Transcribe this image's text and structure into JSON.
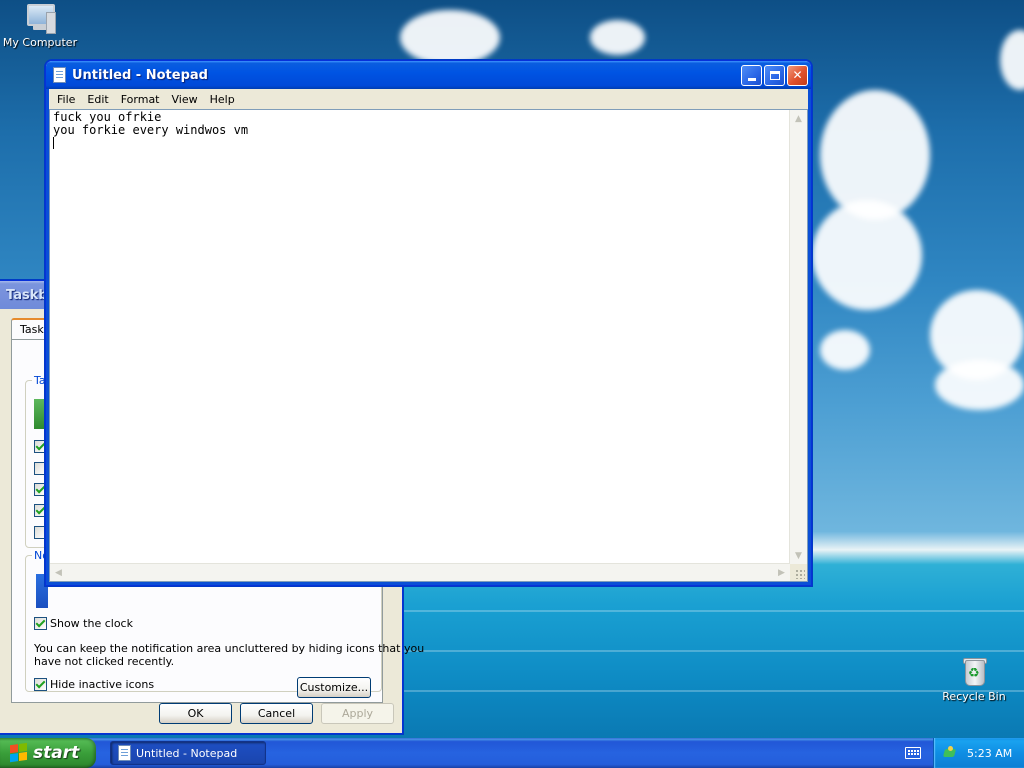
{
  "desktop": {
    "icons": [
      {
        "label": "My Computer",
        "icon": "my-computer-icon"
      },
      {
        "label": "Recycle Bin",
        "icon": "recycle-bin-icon"
      }
    ]
  },
  "notepad": {
    "title": "Untitled - Notepad",
    "menu": [
      "File",
      "Edit",
      "Format",
      "View",
      "Help"
    ],
    "content_lines": [
      "fuck you ofrkie",
      "you forkie every windwos vm"
    ]
  },
  "taskbar_properties": {
    "title_visible": "Taskb",
    "tab_visible": "Taskb",
    "group1_label_visible": "Ta",
    "group2_label_visible": "No",
    "checkboxes_left": [
      {
        "checked": true
      },
      {
        "checked": false
      },
      {
        "checked": true
      },
      {
        "checked": true
      },
      {
        "checked": false
      }
    ],
    "show_clock": {
      "label": "Show the clock",
      "checked": true
    },
    "notification_text_1": "You can keep the notification area uncluttered by hiding icons that you",
    "notification_text_2": "have not clicked recently.",
    "hide_inactive": {
      "label": "Hide inactive icons",
      "checked": true
    },
    "customize_label": "Customize...",
    "ok_label": "OK",
    "cancel_label": "Cancel",
    "apply_label": "Apply"
  },
  "taskbar": {
    "start_label": "start",
    "task_button_label": "Untitled - Notepad",
    "clock": "5:23 AM"
  },
  "colors": {
    "xp_blue": "#0054e3",
    "start_green": "#3a9f3a",
    "tray_blue": "#0f8ee4"
  }
}
